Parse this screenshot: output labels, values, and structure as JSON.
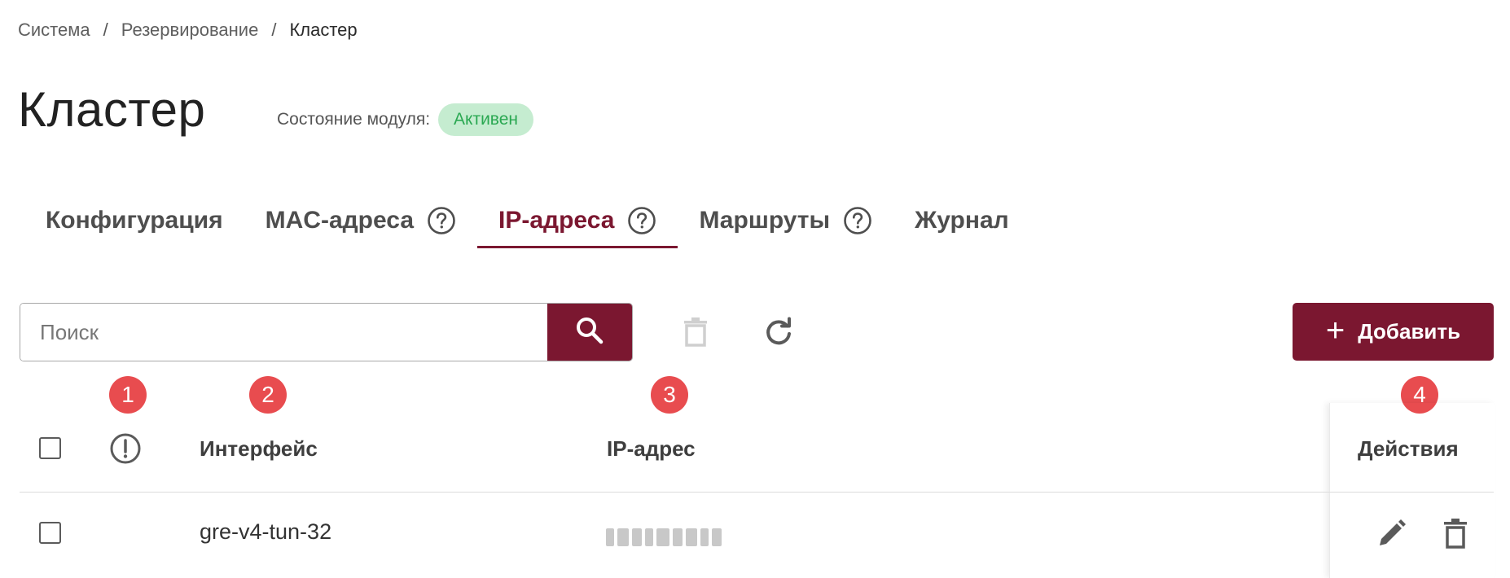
{
  "breadcrumb": {
    "items": [
      "Система",
      "Резервирование",
      "Кластер"
    ],
    "separator": "/"
  },
  "page": {
    "title": "Кластер",
    "status_label": "Состояние модуля:",
    "status_value": "Активен"
  },
  "tabs": [
    {
      "label": "Конфигурация",
      "help": false
    },
    {
      "label": "MAC-адреса",
      "help": true
    },
    {
      "label": "IP-адреса",
      "help": true,
      "active": true
    },
    {
      "label": "Маршруты",
      "help": true
    },
    {
      "label": "Журнал",
      "help": false
    }
  ],
  "toolbar": {
    "search_placeholder": "Поиск",
    "add_label": "Добавить"
  },
  "markers": [
    "1",
    "2",
    "3",
    "4"
  ],
  "table": {
    "columns": {
      "interface": "Интерфейс",
      "ip": "IP-адрес",
      "actions": "Действия"
    },
    "rows": [
      {
        "interface": "gre-v4-tun-32",
        "ip": "[blurred]"
      }
    ]
  },
  "colors": {
    "accent": "#7b1730",
    "badge_bg": "#c5ecd0",
    "badge_text": "#2aa852",
    "marker": "#e84c4f"
  }
}
